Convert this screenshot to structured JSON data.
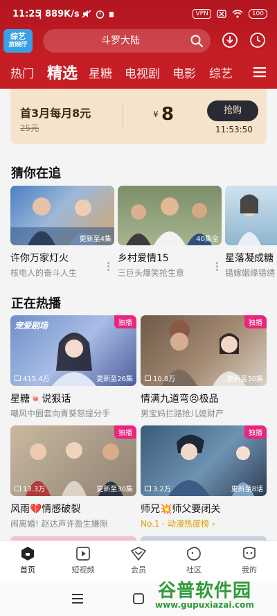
{
  "status_bar": {
    "time": "11:25",
    "speed": "889K/s",
    "vpn": "VPN",
    "battery": "100"
  },
  "header": {
    "logo_line1": "综艺",
    "logo_line2": "放映厅",
    "search_text": "斗罗大陆"
  },
  "tabs": [
    {
      "label": "热门"
    },
    {
      "label": "精选"
    },
    {
      "label": "星糖"
    },
    {
      "label": "电视剧"
    },
    {
      "label": "电影"
    },
    {
      "label": "综艺"
    }
  ],
  "promo": {
    "title": "首3月每月8元",
    "original_price": "25元",
    "currency": "¥",
    "price": "8",
    "button": "抢购",
    "countdown": "11:53:50"
  },
  "guess": {
    "title": "猜你在追",
    "items": [
      {
        "title": "许你万家灯火",
        "sub": "核电人的奋斗人生",
        "badge": "更新至4集"
      },
      {
        "title": "乡村爱情15",
        "sub": "三巨头爆笑抢生意",
        "badge": "40集全"
      },
      {
        "title": "星落凝成糖",
        "sub": "错嫁姻缘错绣",
        "badge": ""
      }
    ]
  },
  "hot": {
    "title": "正在热播",
    "exclusive_label": "独播",
    "items": [
      {
        "title": "星糖🍬说狠话",
        "sub": "嘲风中圈套向青葵怒提分手",
        "views": "415.4万",
        "episode": "更新至26集",
        "exclusive": true,
        "thumb_text": "宠爱剧场"
      },
      {
        "title": "情满九道弯😠极品",
        "sub": "男宝妈拦路抢儿媳财产",
        "views": "10.8万",
        "episode": "更新至30集",
        "exclusive": true
      },
      {
        "title": "风雨💔情感破裂",
        "sub": "闹离婚! 赵达声许盈生嫌隙",
        "views": "13.3万",
        "episode": "更新至30集",
        "exclusive": true
      },
      {
        "title": "师兄💥师父要闭关",
        "rank": "No.1 · 动漫热度榜 ›",
        "views": "3.2万",
        "episode": "更新至8话",
        "exclusive": true
      }
    ]
  },
  "bottom_nav": [
    {
      "label": "首页",
      "icon": "home-icon"
    },
    {
      "label": "短视频",
      "icon": "play-icon"
    },
    {
      "label": "会员",
      "icon": "vip-icon"
    },
    {
      "label": "社区",
      "icon": "community-icon"
    },
    {
      "label": "我的",
      "icon": "profile-icon"
    }
  ],
  "watermark": {
    "text": "谷普软件园",
    "url": "www.gupuxiazai.com"
  },
  "colors": {
    "header_red": "#c41d24",
    "promo_bg": "#f6e3cc",
    "exclusive_pink": "#e8267d",
    "rank_gold": "#d9a200",
    "watermark_green": "#2f9a3a"
  }
}
